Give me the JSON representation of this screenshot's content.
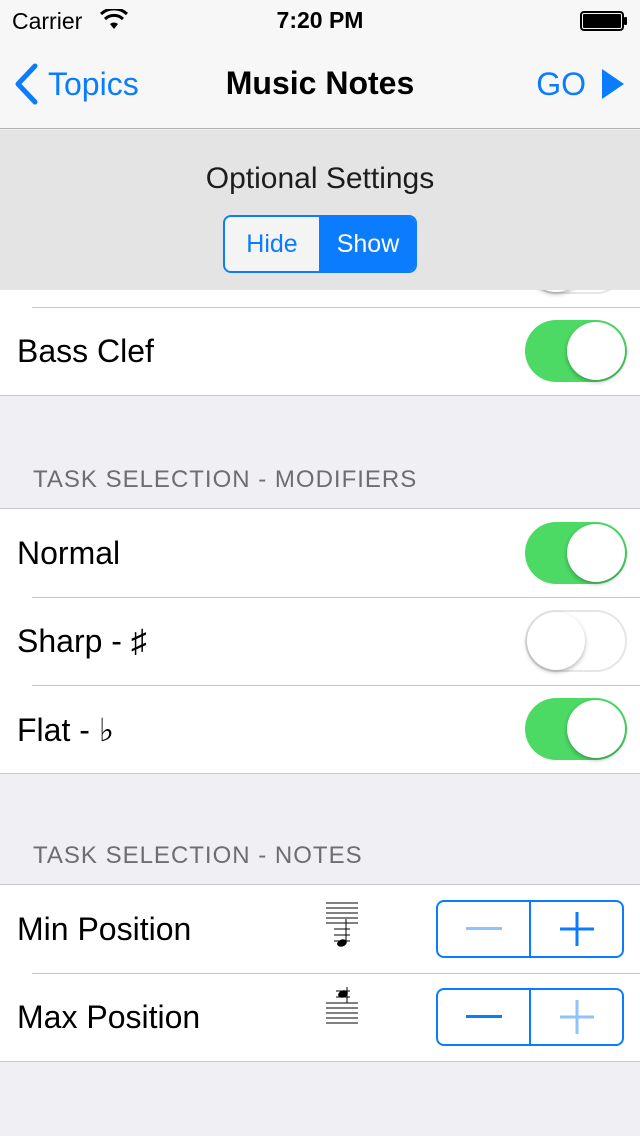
{
  "status_bar": {
    "carrier": "Carrier",
    "time": "7:20 PM"
  },
  "nav": {
    "back_label": "Topics",
    "title": "Music Notes",
    "go_label": "GO"
  },
  "optional_settings": {
    "label": "Optional Settings",
    "segments": [
      "Hide",
      "Show"
    ],
    "selected": "Show"
  },
  "clef_section": {
    "rows": [
      {
        "label": "Bass Clef",
        "on": true
      }
    ]
  },
  "modifiers_section": {
    "header": "TASK SELECTION - MODIFIERS",
    "rows": [
      {
        "label": "Normal",
        "on": true
      },
      {
        "label": "Sharp - ♯",
        "on": false
      },
      {
        "label": "Flat - ♭",
        "on": true
      }
    ]
  },
  "notes_section": {
    "header": "TASK SELECTION - NOTES",
    "rows": [
      {
        "label": "Min Position",
        "minus_enabled": false,
        "plus_enabled": true
      },
      {
        "label": "Max Position",
        "minus_enabled": true,
        "plus_enabled": false
      }
    ]
  },
  "colors": {
    "tint": "#0a7cfd",
    "toggle_on": "#4cd964",
    "background": "#efeff4"
  }
}
